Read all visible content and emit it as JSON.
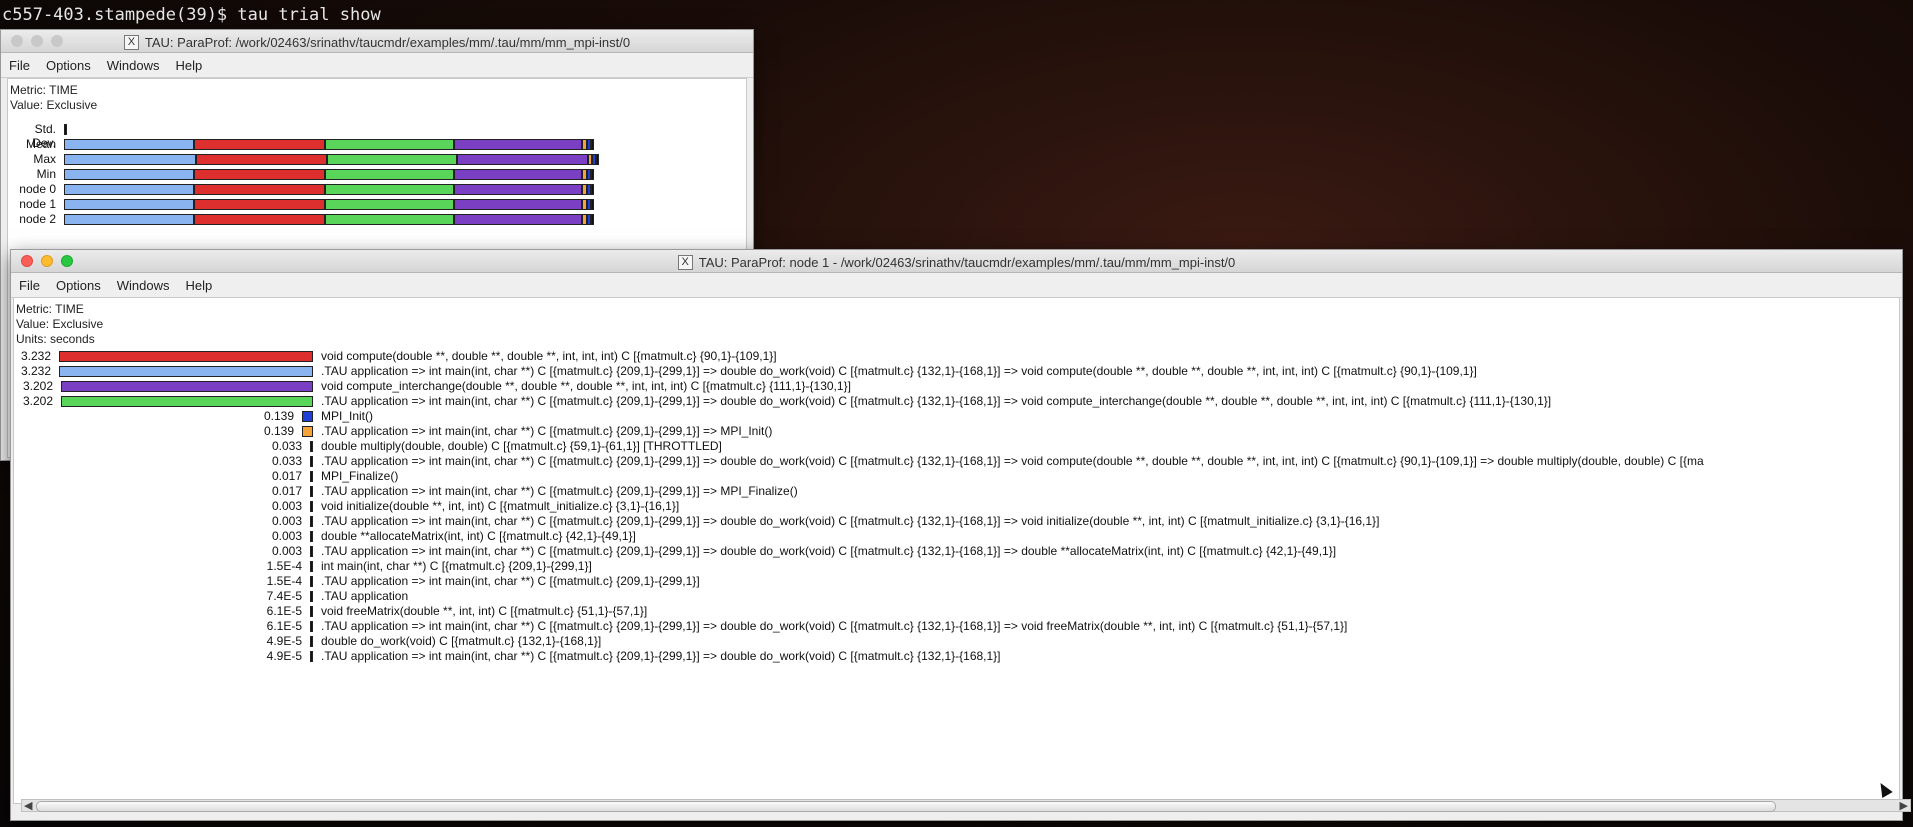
{
  "terminal": {
    "prompt": "c557-403.stampede(39)$ tau trial show"
  },
  "back_window": {
    "title": "TAU: ParaProf: /work/02463/srinathv/taucmdr/examples/mm/.tau/mm/mm_mpi-inst/0",
    "menu": [
      "File",
      "Options",
      "Windows",
      "Help"
    ],
    "metric_label": "Metric: TIME",
    "value_label": "Value: Exclusive",
    "rows": [
      "Std. Dev.",
      "Mean",
      "Max",
      "Min",
      "node 0",
      "node 1",
      "node 2"
    ]
  },
  "front_window": {
    "title": "TAU: ParaProf: node 1 - /work/02463/srinathv/taucmdr/examples/mm/.tau/mm/mm_mpi-inst/0",
    "menu": [
      "File",
      "Options",
      "Windows",
      "Help"
    ],
    "metric_label": "Metric: TIME",
    "value_label": "Value: Exclusive",
    "units_label": "Units: seconds"
  },
  "colors": {
    "blue": "#8ab4f0",
    "red": "#de2f2f",
    "green": "#59d659",
    "purple": "#7b3fc4",
    "orange": "#f4a23a",
    "dark_blue": "#1f3fd6",
    "black": "#111111"
  },
  "chart_data": {
    "type": "bar",
    "ylabel": "Units: seconds",
    "rows": [
      {
        "value": "3.232",
        "num": 3.232,
        "color": "red",
        "label": "void compute(double **, double **, double **, int, int, int) C [{matmult.c} {90,1}-{109,1}]"
      },
      {
        "value": "3.232",
        "num": 3.232,
        "color": "blue",
        "label": ".TAU application => int main(int, char **) C [{matmult.c} {209,1}-{299,1}] => double do_work(void) C [{matmult.c} {132,1}-{168,1}] => void compute(double **, double **, double **, int, int, int) C [{matmult.c} {90,1}-{109,1}]"
      },
      {
        "value": "3.202",
        "num": 3.202,
        "color": "purple",
        "label": "void compute_interchange(double **, double **, double **, int, int, int) C [{matmult.c} {111,1}-{130,1}]"
      },
      {
        "value": "3.202",
        "num": 3.202,
        "color": "green",
        "label": ".TAU application => int main(int, char **) C [{matmult.c} {209,1}-{299,1}] => double do_work(void) C [{matmult.c} {132,1}-{168,1}] => void compute_interchange(double **, double **, double **, int, int, int) C [{matmult.c} {111,1}-{130,1}]"
      },
      {
        "value": "0.139",
        "num": 0.139,
        "color": "dark_blue",
        "label": "MPI_Init()"
      },
      {
        "value": "0.139",
        "num": 0.139,
        "color": "orange",
        "label": ".TAU application => int main(int, char **) C [{matmult.c} {209,1}-{299,1}] => MPI_Init()"
      },
      {
        "value": "0.033",
        "num": 0.033,
        "color": "black",
        "label": "double multiply(double, double) C [{matmult.c} {59,1}-{61,1}] [THROTTLED]"
      },
      {
        "value": "0.033",
        "num": 0.033,
        "color": "black",
        "label": ".TAU application => int main(int, char **) C [{matmult.c} {209,1}-{299,1}] => double do_work(void) C [{matmult.c} {132,1}-{168,1}] => void compute(double **, double **, double **, int, int, int) C [{matmult.c} {90,1}-{109,1}] => double multiply(double, double) C [{ma"
      },
      {
        "value": "0.017",
        "num": 0.017,
        "color": "black",
        "label": "MPI_Finalize()"
      },
      {
        "value": "0.017",
        "num": 0.017,
        "color": "black",
        "label": ".TAU application => int main(int, char **) C [{matmult.c} {209,1}-{299,1}] => MPI_Finalize()"
      },
      {
        "value": "0.003",
        "num": 0.003,
        "color": "black",
        "label": "void initialize(double **, int, int) C [{matmult_initialize.c} {3,1}-{16,1}]"
      },
      {
        "value": "0.003",
        "num": 0.003,
        "color": "black",
        "label": ".TAU application => int main(int, char **) C [{matmult.c} {209,1}-{299,1}] => double do_work(void) C [{matmult.c} {132,1}-{168,1}] => void initialize(double **, int, int) C [{matmult_initialize.c} {3,1}-{16,1}]"
      },
      {
        "value": "0.003",
        "num": 0.003,
        "color": "black",
        "label": "double **allocateMatrix(int, int) C [{matmult.c} {42,1}-{49,1}]"
      },
      {
        "value": "0.003",
        "num": 0.003,
        "color": "black",
        "label": ".TAU application => int main(int, char **) C [{matmult.c} {209,1}-{299,1}] => double do_work(void) C [{matmult.c} {132,1}-{168,1}] => double **allocateMatrix(int, int) C [{matmult.c} {42,1}-{49,1}]"
      },
      {
        "value": "1.5E-4",
        "num": 0.00015,
        "color": "black",
        "label": "int main(int, char **) C [{matmult.c} {209,1}-{299,1}]"
      },
      {
        "value": "1.5E-4",
        "num": 0.00015,
        "color": "black",
        "label": ".TAU application => int main(int, char **) C [{matmult.c} {209,1}-{299,1}]"
      },
      {
        "value": "7.4E-5",
        "num": 7.4e-05,
        "color": "black",
        "label": ".TAU application"
      },
      {
        "value": "6.1E-5",
        "num": 6.1e-05,
        "color": "black",
        "label": "void freeMatrix(double **, int, int) C [{matmult.c} {51,1}-{57,1}]"
      },
      {
        "value": "6.1E-5",
        "num": 6.1e-05,
        "color": "black",
        "label": ".TAU application => int main(int, char **) C [{matmult.c} {209,1}-{299,1}] => double do_work(void) C [{matmult.c} {132,1}-{168,1}] => void freeMatrix(double **, int, int) C [{matmult.c} {51,1}-{57,1}]"
      },
      {
        "value": "4.9E-5",
        "num": 4.9e-05,
        "color": "black",
        "label": "double do_work(void) C [{matmult.c} {132,1}-{168,1}]"
      },
      {
        "value": "4.9E-5",
        "num": 4.9e-05,
        "color": "black",
        "label": ".TAU application => int main(int, char **) C [{matmult.c} {209,1}-{299,1}] => double do_work(void) C [{matmult.c} {132,1}-{168,1}]"
      }
    ]
  }
}
